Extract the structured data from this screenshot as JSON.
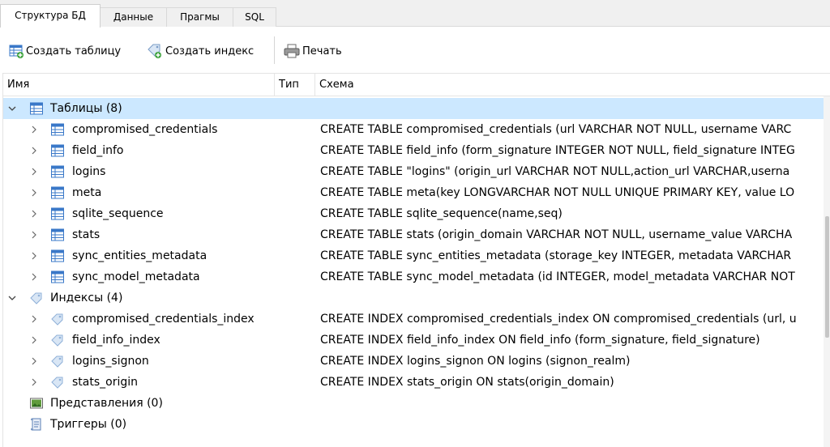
{
  "tabs": [
    {
      "label": "Структура БД",
      "active": true
    },
    {
      "label": "Данные",
      "active": false
    },
    {
      "label": "Прагмы",
      "active": false
    },
    {
      "label": "SQL",
      "active": false
    }
  ],
  "toolbar": {
    "create_table": "Создать таблицу",
    "create_index": "Создать индекс",
    "print": "Печать"
  },
  "columns": {
    "name": "Имя",
    "type": "Тип",
    "schema": "Схема"
  },
  "groups": {
    "tables": "Таблицы (8)",
    "indexes": "Индексы (4)",
    "views": "Представления (0)",
    "triggers": "Триггеры (0)"
  },
  "tables": [
    {
      "name": "compromised_credentials",
      "schema": "CREATE TABLE compromised_credentials (url VARCHAR NOT NULL, username VARC"
    },
    {
      "name": "field_info",
      "schema": "CREATE TABLE field_info (form_signature INTEGER NOT NULL, field_signature INTEG"
    },
    {
      "name": "logins",
      "schema": "CREATE TABLE \"logins\" (origin_url VARCHAR NOT NULL,action_url VARCHAR,userna"
    },
    {
      "name": "meta",
      "schema": "CREATE TABLE meta(key LONGVARCHAR NOT NULL UNIQUE PRIMARY KEY, value LO"
    },
    {
      "name": "sqlite_sequence",
      "schema": "CREATE TABLE sqlite_sequence(name,seq)"
    },
    {
      "name": "stats",
      "schema": "CREATE TABLE stats (origin_domain VARCHAR NOT NULL, username_value VARCHA"
    },
    {
      "name": "sync_entities_metadata",
      "schema": "CREATE TABLE sync_entities_metadata (storage_key INTEGER, metadata VARCHAR"
    },
    {
      "name": "sync_model_metadata",
      "schema": "CREATE TABLE sync_model_metadata (id INTEGER, model_metadata VARCHAR NOT"
    }
  ],
  "indexes": [
    {
      "name": "compromised_credentials_index",
      "schema": "CREATE INDEX compromised_credentials_index ON compromised_credentials (url, u"
    },
    {
      "name": "field_info_index",
      "schema": "CREATE INDEX field_info_index ON field_info (form_signature, field_signature)"
    },
    {
      "name": "logins_signon",
      "schema": "CREATE INDEX logins_signon ON logins (signon_realm)"
    },
    {
      "name": "stats_origin",
      "schema": "CREATE INDEX stats_origin ON stats(origin_domain)"
    }
  ],
  "colors": {
    "selection": "#cce8ff",
    "table_icon": "#3a78c8",
    "index_icon": "#8fb0d8"
  }
}
